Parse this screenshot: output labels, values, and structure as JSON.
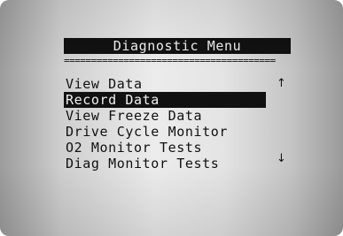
{
  "title": "Diagnostic Menu",
  "separator": "=======================================",
  "menu": {
    "items": [
      {
        "label": "View Data"
      },
      {
        "label": "Record Data"
      },
      {
        "label": "View Freeze Data"
      },
      {
        "label": "Drive Cycle Monitor"
      },
      {
        "label": "O2 Monitor Tests"
      },
      {
        "label": "Diag Monitor Tests"
      }
    ],
    "selected_index": 1
  },
  "scroll": {
    "up_glyph": "↑",
    "down_glyph": "↓"
  }
}
